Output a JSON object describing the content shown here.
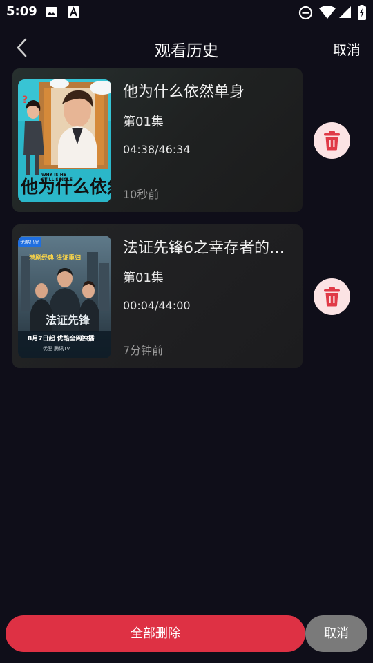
{
  "status_bar": {
    "time": "5:09",
    "icons": [
      "image-icon",
      "a-icon",
      "dnd-icon",
      "wifi-icon",
      "signal-icon",
      "battery-charging-icon"
    ]
  },
  "header": {
    "back_icon": "chevron-left-icon",
    "title": "观看历史",
    "cancel_label": "取消"
  },
  "history": [
    {
      "title": "他为什么依然单身",
      "episode": "第01集",
      "progress": "04:38/46:34",
      "watched_ago": "10秒前",
      "poster": {
        "title_text": "他为什么依然单身",
        "subtitle_text": "WHY IS HE STILL SINGLE"
      },
      "delete_icon": "trash-icon"
    },
    {
      "title": "法证先锋6之幸存者的…",
      "episode": "第01集",
      "progress": "00:04/44:00",
      "watched_ago": "7分钟前",
      "poster": {
        "badge": "优酷出品",
        "tagline": "港剧经典 法证重归",
        "show_title": "法证先锋",
        "release": "8月7日起 优酷全网独播",
        "platforms": "优酷  腾讯TV"
      },
      "delete_icon": "trash-icon"
    }
  ],
  "footer": {
    "delete_all_label": "全部删除",
    "cancel_label": "取消"
  },
  "colors": {
    "background": "#0f0e19",
    "accent_red": "#de3144",
    "delete_circle": "#fbe3e4",
    "cancel_gray": "#7a7a7a"
  }
}
